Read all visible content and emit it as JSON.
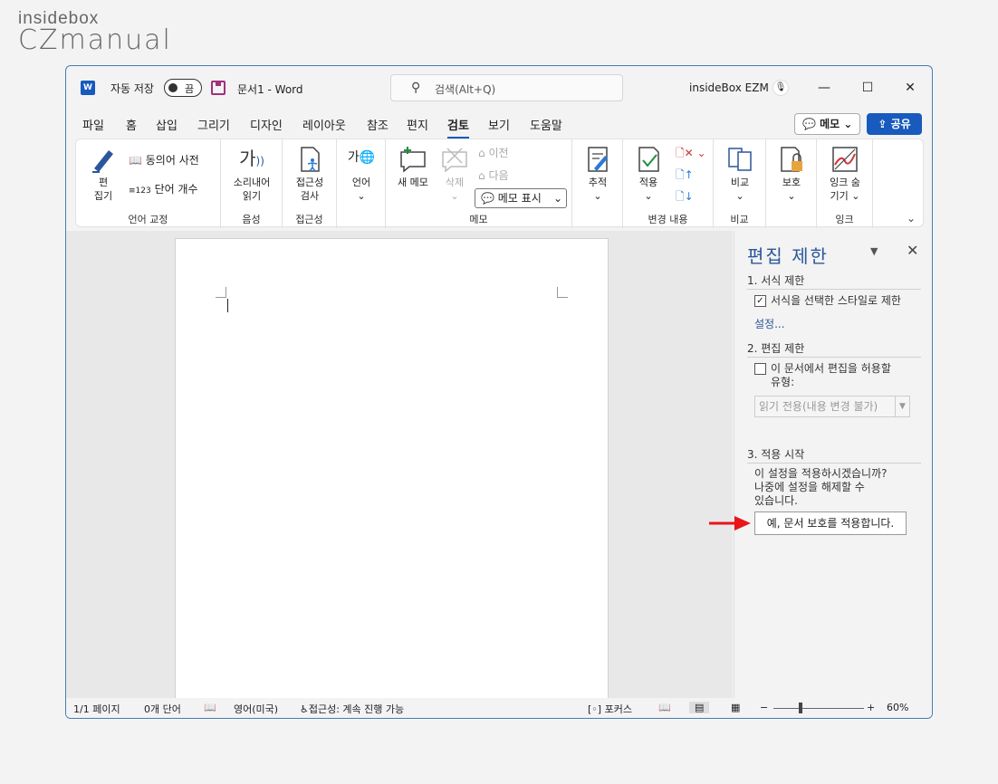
{
  "watermark": {
    "line1": "insidebox",
    "line2": "CZmanual"
  },
  "titlebar": {
    "app_icon": "W",
    "autosave_label": "자동 저장",
    "autosave_state": "끔",
    "doc_title": "문서1  -  Word",
    "search_placeholder": "검색(Alt+Q)",
    "user_name": "insideBox EZM",
    "window_buttons": {
      "minimize": "—",
      "maximize": "☐",
      "close": "✕"
    }
  },
  "menu": {
    "tabs": [
      "파일",
      "홈",
      "삽입",
      "그리기",
      "디자인",
      "레이아웃",
      "참조",
      "편지",
      "검토",
      "보기",
      "도움말"
    ],
    "active_tab": "검토",
    "memo_button": "메모",
    "share_button": "공유"
  },
  "ribbon": {
    "proofing": {
      "edit_btn": "편\n집기",
      "thesaurus": "동의어 사전",
      "wordcount": "단어 개수",
      "label": "언어 교정"
    },
    "speech": {
      "read_aloud": "소리내어\n읽기",
      "label": "음성"
    },
    "accessibility": {
      "check": "접근성\n검사",
      "label": "접근성"
    },
    "language": {
      "btn": "언어",
      "label": ""
    },
    "comments": {
      "new": "새 메모",
      "delete": "삭제",
      "prev": "이전",
      "next": "다음",
      "show": "메모 표시",
      "label": "메모"
    },
    "tracking": {
      "btn": "추적",
      "label": ""
    },
    "changes": {
      "apply": "적용",
      "label": "변경 내용"
    },
    "compare": {
      "btn": "비교",
      "label": "비교"
    },
    "protect": {
      "btn": "보호",
      "label": ""
    },
    "ink": {
      "btn": "잉크 숨\n기기",
      "label": "잉크"
    }
  },
  "pane": {
    "title": "편집 제한",
    "section1": "1. 서식 제한",
    "format_check_label": "서식을 선택한 스타일로 제한",
    "format_checked": true,
    "settings_link": "설정...",
    "section2": "2. 편집 제한",
    "edit_check_label": "이 문서에서 편집을 허용할\n유형:",
    "edit_checked": false,
    "edit_select_value": "읽기 전용(내용 변경 불가)",
    "section3": "3. 적용 시작",
    "apply_prompt": "이 설정을 적용하시겠습니까?\n나중에 설정을 해제할 수\n있습니다.",
    "apply_button": "예, 문서 보호를 적용합니다."
  },
  "statusbar": {
    "page": "1/1 페이지",
    "words": "0개 단어",
    "language": "영어(미국)",
    "accessibility": "접근성: 계속 진행 가능",
    "focus": "포커스",
    "zoom_minus": "−",
    "zoom_plus": "+",
    "zoom": "60%",
    "zoom_fraction": 0.28
  },
  "annotation": {
    "arrow_color": "#e8151b"
  },
  "colors": {
    "accent": "#185abd",
    "pane_title": "#2b579a",
    "save_icon": "#a0317f"
  }
}
